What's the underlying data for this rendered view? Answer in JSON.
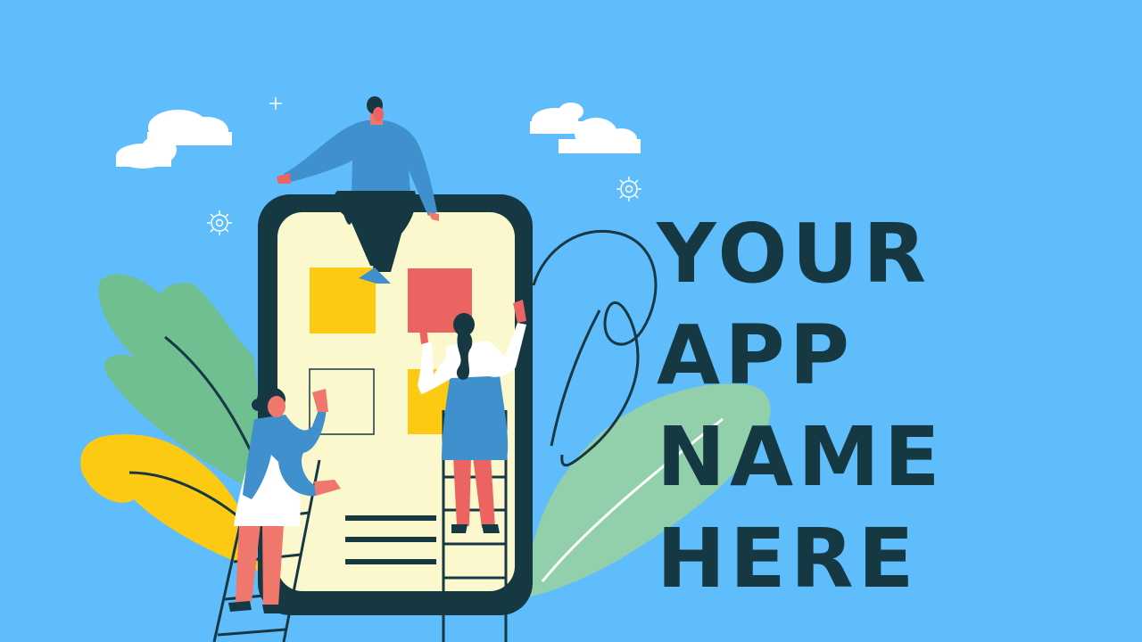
{
  "title": {
    "lines": [
      "YOUR",
      "APP",
      "NAME",
      "HERE"
    ]
  },
  "colors": {
    "background": "#5fbdfc",
    "dark": "#163842",
    "screen": "#fbf8cd",
    "yellow": "#fcca13",
    "coral": "#ec6462",
    "blue": "#3f90cd",
    "skin": "#ef776b",
    "leaf_green": "#6fbf91",
    "leaf_light": "#92cfab",
    "white": "#ffffff"
  },
  "icons": [
    "cloud-icon",
    "gear-icon",
    "sparkle-icon"
  ]
}
